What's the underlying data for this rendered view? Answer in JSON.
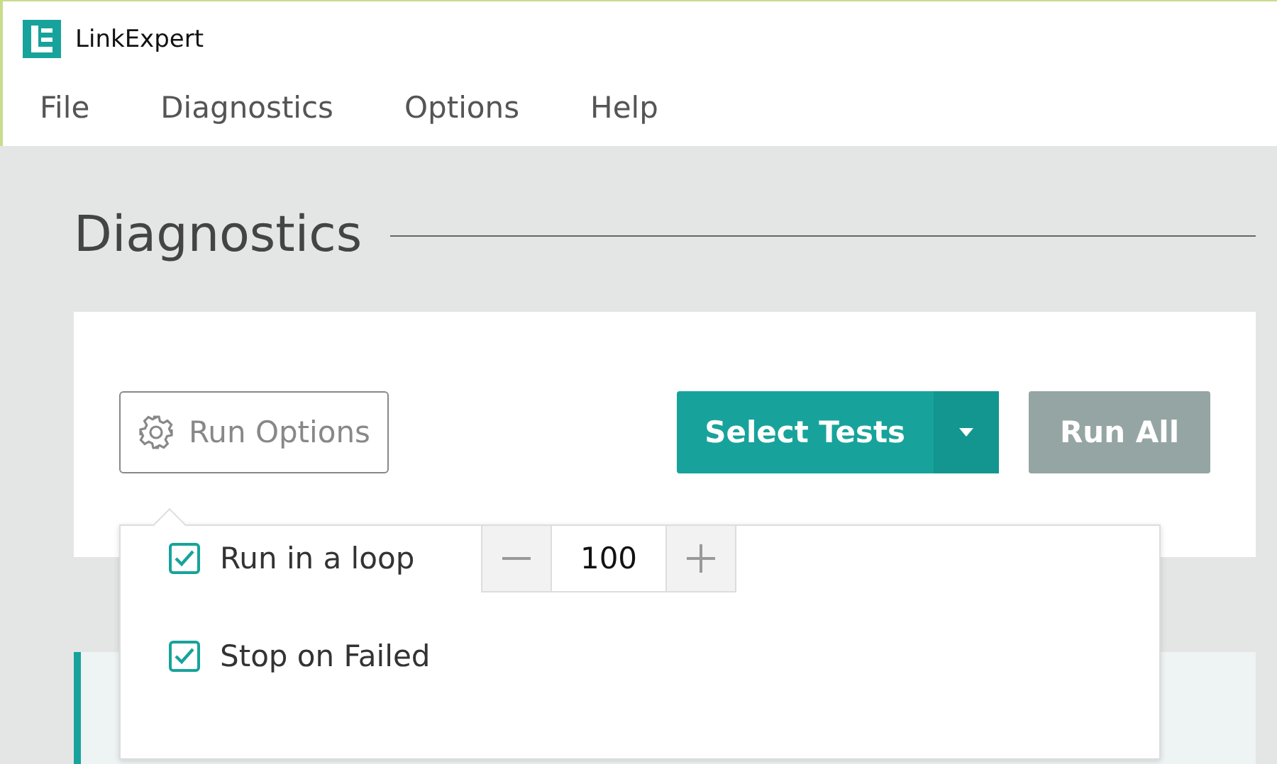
{
  "window": {
    "title": "LinkExpert"
  },
  "menu": [
    {
      "label": "File"
    },
    {
      "label": "Diagnostics"
    },
    {
      "label": "Options"
    },
    {
      "label": "Help"
    }
  ],
  "page": {
    "heading": "Diagnostics"
  },
  "toolbar": {
    "run_options": "Run Options",
    "select_tests": "Select Tests",
    "run_all": {
      "label": "Run All",
      "disabled": true
    }
  },
  "run_options_popup": {
    "options": [
      {
        "kind": "stepper",
        "label": "Run in a loop",
        "checked": true,
        "value": "100"
      },
      {
        "kind": "plain",
        "label": "Stop on Failed",
        "checked": true
      }
    ]
  }
}
